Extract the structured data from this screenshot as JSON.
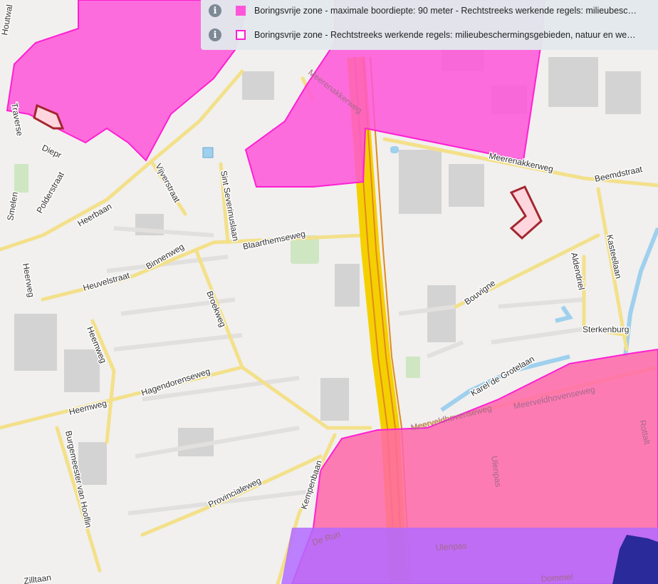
{
  "legend": {
    "items": [
      {
        "icon": "info-icon",
        "swatch": "filled",
        "color": "#ff55d8",
        "label": "Boringsvrije zone - maximale boordiepte: 90 meter - Rechtstreeks werkende regels: milieubesc…"
      },
      {
        "icon": "info-icon",
        "swatch": "outline",
        "color": "#ff1fd4",
        "label": "Boringsvrije zone - Rechtstreeks werkende regels: milieubeschermingsgebieden, natuur en we…"
      }
    ]
  },
  "streets": {
    "houtwal": "Houtwal",
    "traverse": "Traverse",
    "diepr": "Diepr",
    "polderstraat": "Polderstraat",
    "smelen": "Smelen",
    "heerbaan": "Heerbaan",
    "vijverstraat": "Vijverstraat",
    "sint_severinuslaan": "Sint Severinuslaan",
    "blaarthemseweg": "Blaarthemseweg",
    "heuvelstraat": "Heuvelstraat",
    "binnenweg": "Binnenweg",
    "heerweg": "Heerweg",
    "broekweg": "Broekweg",
    "heemweg_diag": "Heemweg",
    "hagendorenseweg": "Hagendorenseweg",
    "heemweg": "Heemweg",
    "burgemeester": "Burgemeester van Hooflin",
    "zandstraat": "Zilltaan",
    "provincialeweg": "Provincialeweg",
    "kempenbaan": "Kempenbaan",
    "meerenakkerweg_top": "Meerenakkerweg",
    "meerenakkerweg": "Meerenakkerweg",
    "beemdstraat": "Beemdstraat",
    "kasteellaan": "Kasteellaan",
    "aldendriel": "Aldendriel",
    "bouvigne": "Bouvigne",
    "sterkenburg": "Sterkenburg",
    "karel_de_grotelaan": "Karel de Grotelaan",
    "meerveldhovenseweg": "Meerveldhovenseweg",
    "meerveldhovenseweg2": "Meerveldhovenseweg",
    "uienpas": "Ulenpas",
    "ulenpas": "Ulenpas",
    "de_run": "De Run",
    "rottalt": "Rottalt",
    "dommel": "Dommel"
  },
  "colors": {
    "zone_fill": "#ff55d8",
    "zone_stroke": "#ff1fd4",
    "purple_zone": "#b36bff",
    "highway": "#f5d000",
    "road": "#f3e08a",
    "water": "#9fd0ee",
    "marker_fill": "#ffd6de",
    "marker_stroke": "#a3262e"
  }
}
